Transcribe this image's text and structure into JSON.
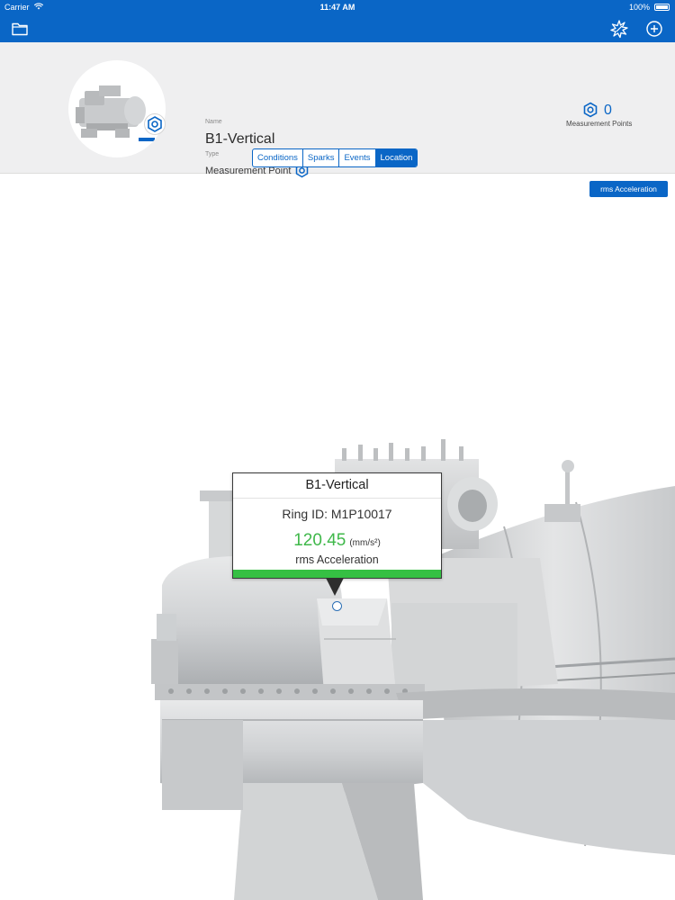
{
  "status_bar": {
    "carrier": "Carrier",
    "time": "11:47 AM",
    "battery": "100%"
  },
  "nav": {
    "left_icon": "folder-icon",
    "right_icons": [
      "sparks-icon",
      "add-icon"
    ]
  },
  "asset": {
    "name_label": "Name",
    "name": "B1-Vertical",
    "type_label": "Type",
    "type": "Measurement Point",
    "type_icon": "measurement-point-icon"
  },
  "measurement_points": {
    "count": "0",
    "label": "Measurement Points"
  },
  "tabs": [
    {
      "label": "Conditions",
      "active": false
    },
    {
      "label": "Sparks",
      "active": false
    },
    {
      "label": "Events",
      "active": false
    },
    {
      "label": "Location",
      "active": true
    }
  ],
  "metric_button": "rms Acceleration",
  "callout": {
    "title": "B1-Vertical",
    "ring_id": "Ring ID: M1P10017",
    "value": "120.45",
    "unit": "(mm/s²)",
    "metric": "rms Acceleration"
  },
  "colors": {
    "brand_blue": "#0a66c6",
    "value_green": "#3fb84a",
    "header_bg": "#efeff0"
  }
}
